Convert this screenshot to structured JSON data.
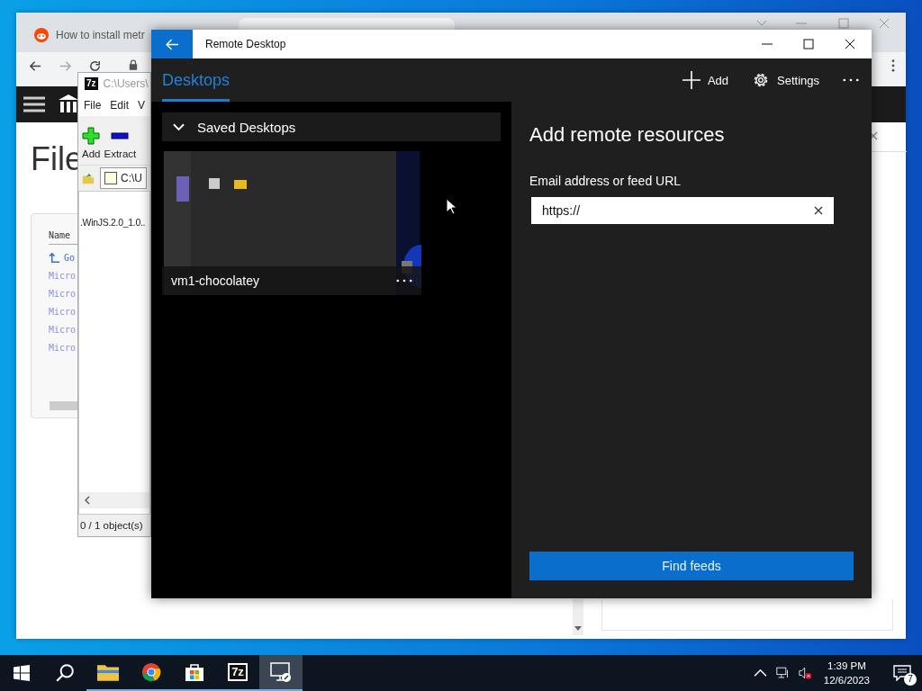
{
  "browser": {
    "tabs": [
      {
        "title": "How to install metr",
        "selected": false
      },
      {
        "selected": true
      }
    ],
    "page_heading": "File",
    "table": {
      "header": "Name",
      "rows": [
        {
          "kind": "parent",
          "text": "Go"
        },
        {
          "kind": "file",
          "text": "Micro"
        },
        {
          "kind": "file",
          "text": "Micro"
        },
        {
          "kind": "file",
          "text": "Micro"
        },
        {
          "kind": "file",
          "text": "Micro"
        },
        {
          "kind": "file",
          "text": "Micro"
        }
      ]
    }
  },
  "sevenzip": {
    "logo": "7z",
    "title": "C:\\Users\\",
    "menu": [
      "File",
      "Edit",
      "V"
    ],
    "toolbar": [
      {
        "kind": "add",
        "label": "Add"
      },
      {
        "kind": "extract",
        "label": "Extract"
      }
    ],
    "path": "C:\\U",
    "items": [
      ".WinJS.2.0_1.0.."
    ],
    "status": "0 / 1 object(s)"
  },
  "remote_desktop": {
    "title": "Remote Desktop",
    "tabs": [
      {
        "label": "Desktops",
        "selected": true
      }
    ],
    "actions": [
      {
        "kind": "add",
        "label": "Add"
      },
      {
        "kind": "settings",
        "label": "Settings"
      },
      {
        "kind": "more"
      }
    ],
    "group": {
      "label": "Saved Desktops",
      "expanded": true
    },
    "desktops": [
      {
        "name": "vm1-chocolatey",
        "kind": "picture"
      }
    ],
    "panel": {
      "title": "Add remote resources",
      "field_label": "Email address or feed URL",
      "field_value": "https://",
      "button": "Find feeds"
    }
  },
  "taskbar": {
    "apps": [
      {
        "kind": "search",
        "running": false,
        "selected": false
      },
      {
        "kind": "explorer",
        "running": true,
        "selected": false
      },
      {
        "kind": "chrome",
        "running": true,
        "selected": false
      },
      {
        "kind": "store",
        "running": true,
        "selected": false
      },
      {
        "kind": "sevenzip",
        "label": "7z",
        "running": true,
        "selected": false
      },
      {
        "kind": "rdp",
        "running": true,
        "selected": true
      }
    ],
    "time": "1:39 PM",
    "date": "12/6/2023",
    "notifications": "7"
  }
}
